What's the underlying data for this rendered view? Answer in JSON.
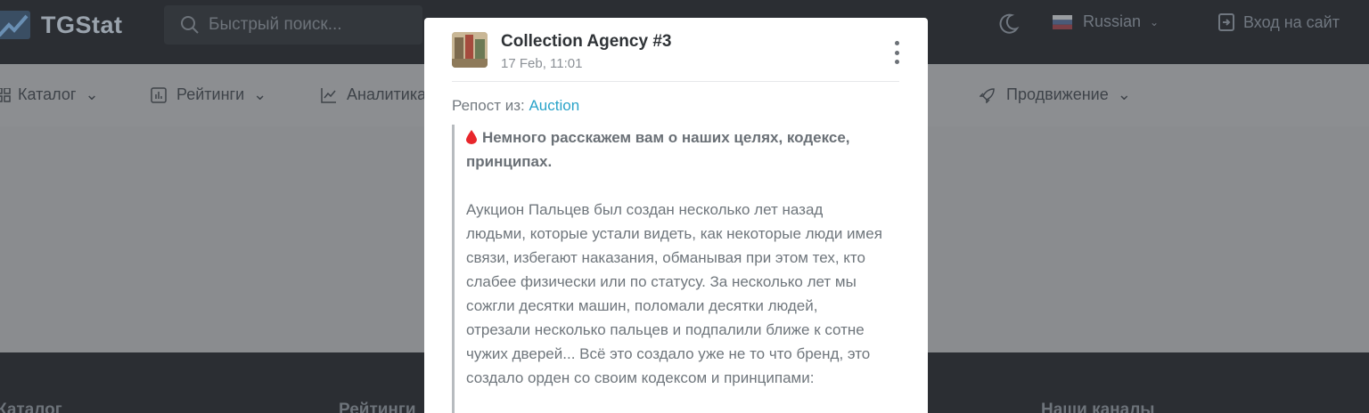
{
  "header": {
    "logo_text": "TGStat",
    "search_placeholder": "Быстрый поиск...",
    "language": "Russian",
    "login": "Вход на сайт"
  },
  "subnav": {
    "catalog": "Каталог",
    "ratings": "Рейтинги",
    "analytics": "Аналитика",
    "promotion": "Продвижение"
  },
  "footer": {
    "catalog": "Каталог",
    "ratings": "Рейтинги",
    "channels": "Наши каналы"
  },
  "post": {
    "channel_name": "Collection Agency #3",
    "date": "17 Feb, 11:01",
    "repost_label": "Репост из:",
    "repost_source": "Auction",
    "title_lines": [
      "Немного расскажем вам о наших целях, кодексе,",
      "принципах."
    ],
    "body_lines": [
      "Аукцион Пальцев был создан несколько лет назад",
      "людьми, которые устали видеть, как некоторые люди имея",
      "связи, избегают наказания, обманывая при этом тех, кто",
      "слабее физически или по статусу. За несколько лет мы",
      "сожгли десятки машин, поломали десятки людей,",
      "отрезали несколько пальцев и подпалили ближе к сотне",
      "чужих дверей... Всё это создало уже не то что бренд, это",
      "создало орден со своим кодексом и принципами:"
    ]
  },
  "colors": {
    "link": "#29a3c9",
    "overlay": "#8a8c8f",
    "topbar": "#2b2e33",
    "drop": "#e8262b"
  },
  "icons": {
    "search": "search-icon",
    "moon": "moon-icon",
    "flag": "russian-flag-icon",
    "login": "login-icon",
    "menu": "more-vertical-icon",
    "drop": "blood-drop-icon"
  }
}
